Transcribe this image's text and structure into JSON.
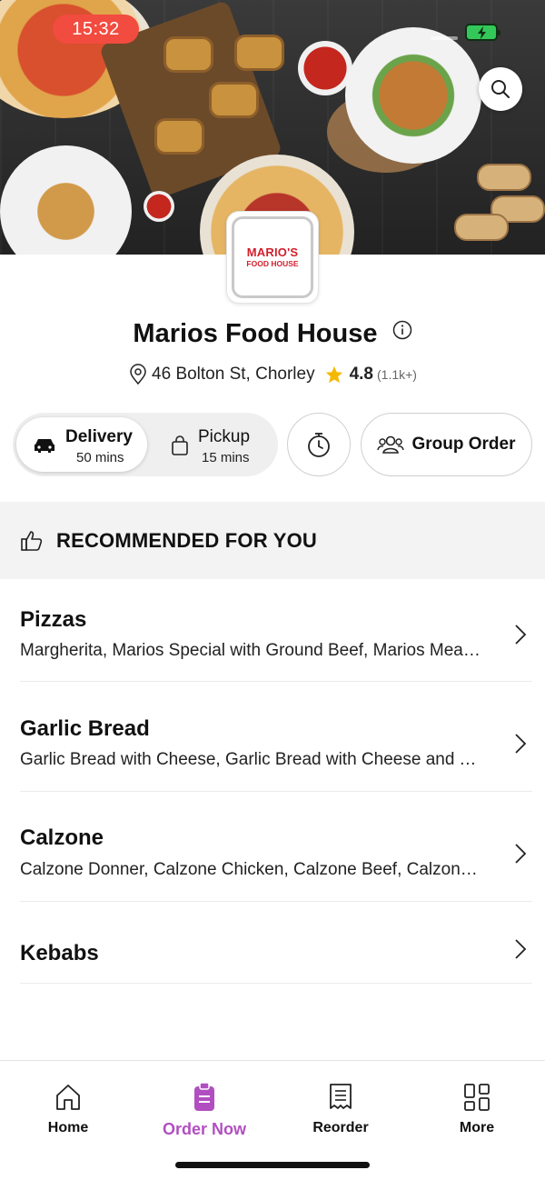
{
  "status_bar": {
    "time": "15:32"
  },
  "hero": {
    "search_icon": "search-icon"
  },
  "restaurant": {
    "logo_line1": "MARIO'S",
    "logo_line2": "FOOD HOUSE",
    "name": "Marios Food House",
    "address": "46 Bolton St, Chorley",
    "rating": "4.8",
    "rating_count": "(1.1k+)"
  },
  "order_mode": {
    "delivery_label": "Delivery",
    "delivery_time": "50 mins",
    "pickup_label": "Pickup",
    "pickup_time": "15 mins",
    "selected": "Delivery"
  },
  "group_order_label": "Group Order",
  "recommended_label": "RECOMMENDED FOR YOU",
  "categories": [
    {
      "name": "Pizzas",
      "description": "Margherita, Marios Special with Ground Beef, Marios Meat Feast"
    },
    {
      "name": "Garlic Bread",
      "description": "Garlic Bread with Cheese, Garlic Bread with Cheese and Tomato"
    },
    {
      "name": "Calzone",
      "description": "Calzone Donner, Calzone Chicken, Calzone Beef, Calzone Special"
    },
    {
      "name": "Kebabs",
      "description": ""
    }
  ],
  "bottom_nav": [
    {
      "label": "Home",
      "icon": "home-icon"
    },
    {
      "label": "Order Now",
      "icon": "order-icon",
      "active": true
    },
    {
      "label": "Reorder",
      "icon": "receipt-icon"
    },
    {
      "label": "More",
      "icon": "grid-icon"
    }
  ],
  "colors": {
    "accent": "#b14fc0",
    "status_red": "#f24b3f",
    "star": "#f5b800",
    "logo_red": "#d21f2b"
  }
}
